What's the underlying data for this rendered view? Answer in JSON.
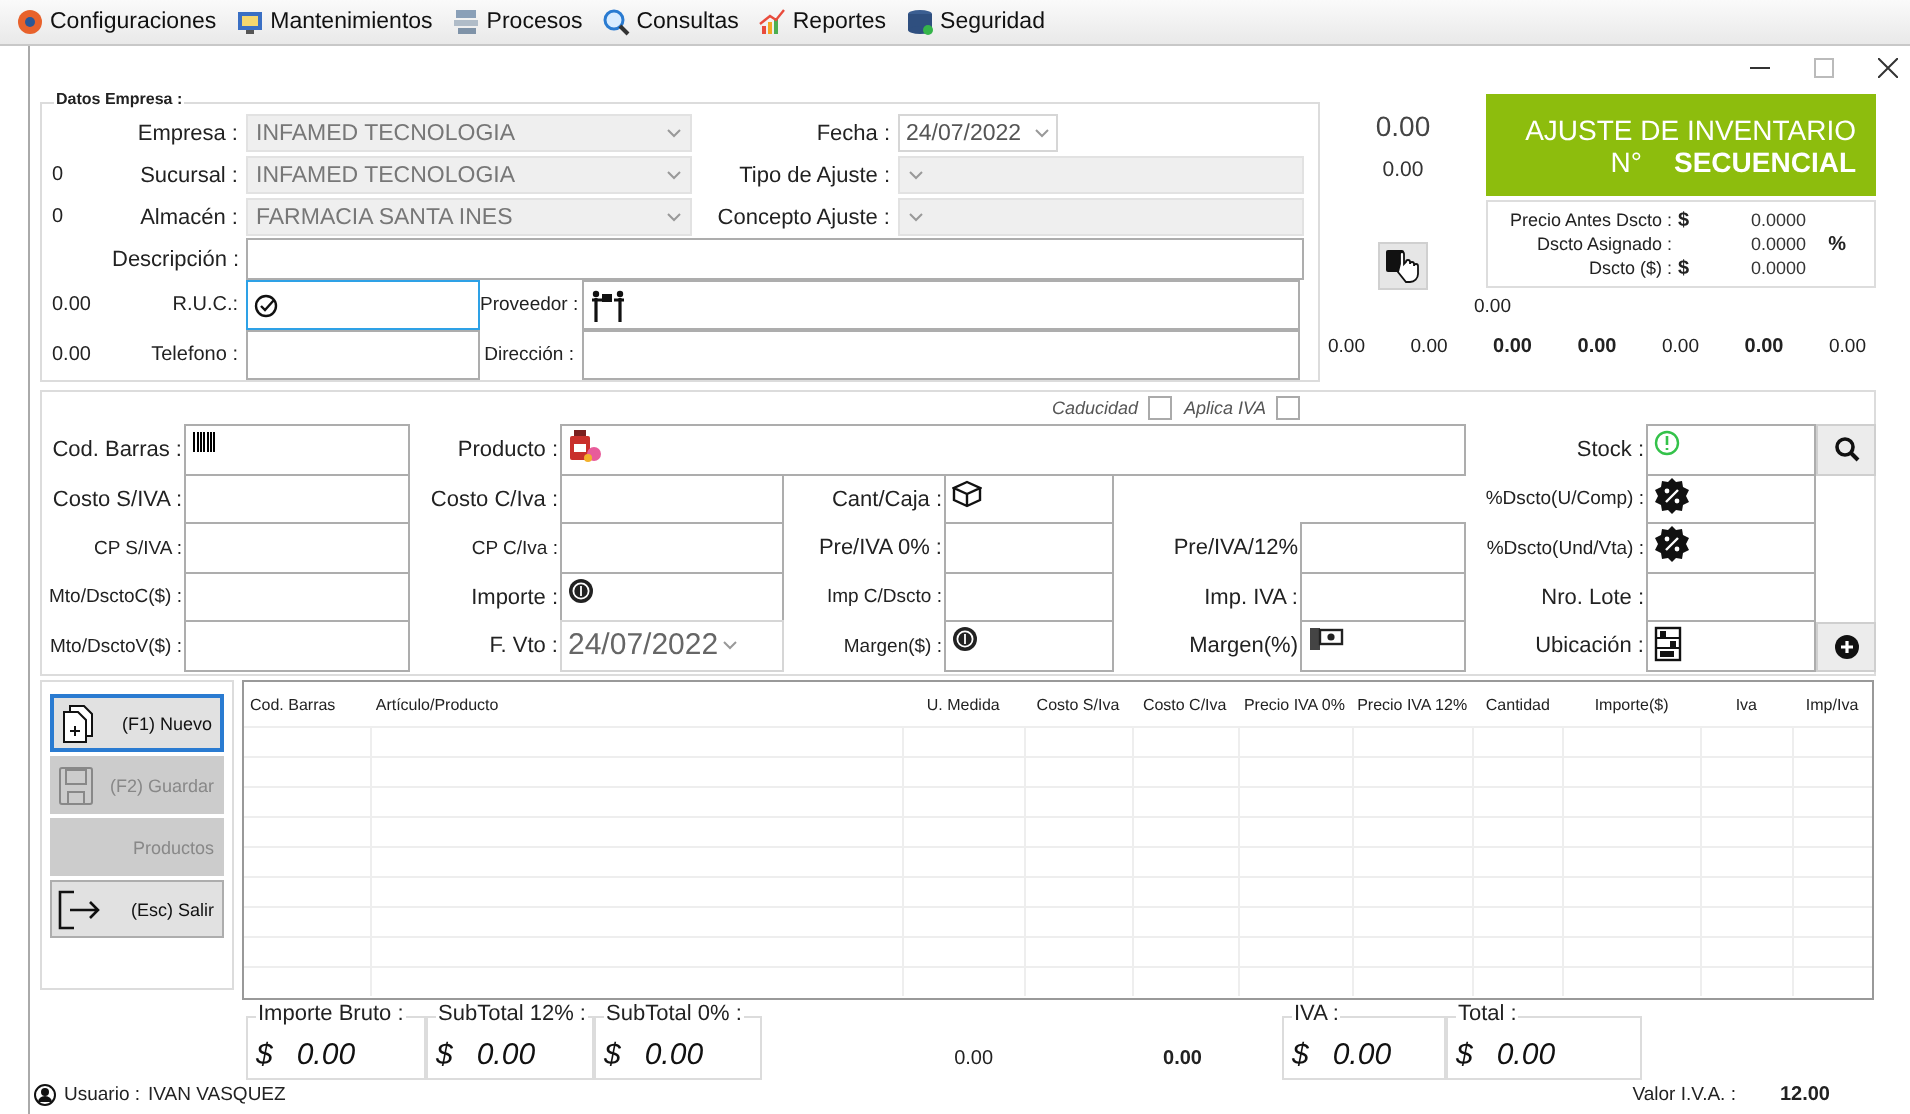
{
  "menu": [
    {
      "label": "Configuraciones"
    },
    {
      "label": "Mantenimientos"
    },
    {
      "label": "Procesos"
    },
    {
      "label": "Consultas"
    },
    {
      "label": "Reportes"
    },
    {
      "label": "Seguridad"
    }
  ],
  "company": {
    "title": "Datos Empresa :",
    "empresa": {
      "label": "Empresa :",
      "value": "INFAMED TECNOLOGIA",
      "disabled": true
    },
    "sucursal": {
      "code": "0",
      "label": "Sucursal :",
      "value": "INFAMED TECNOLOGIA",
      "disabled": true
    },
    "almacen": {
      "code": "0",
      "label": "Almacén :",
      "value": "FARMACIA SANTA INES",
      "disabled": true
    },
    "fecha": {
      "label": "Fecha :",
      "value": "24/07/2022"
    },
    "tipo_ajuste": {
      "label": "Tipo de Ajuste :"
    },
    "concepto_ajuste": {
      "label": "Concepto Ajuste :"
    },
    "descripcion": {
      "label": "Descripción :"
    },
    "ruc": {
      "code": "0.00",
      "label": "R.U.C.:",
      "focused": true
    },
    "proveedor": {
      "label": "Proveedor :"
    },
    "telefono": {
      "code": "0.00",
      "label": "Telefono :",
      "focused": false
    },
    "direccion": {
      "label": "Dirección :"
    }
  },
  "summary": {
    "big_value": "0.00",
    "small_value": "0.00",
    "side_value": "0.00",
    "totals": [
      {
        "value": "0.00",
        "bold": false
      },
      {
        "value": "0.00",
        "bold": false
      },
      {
        "value": "0.00",
        "bold": true
      },
      {
        "value": "0.00",
        "bold": true
      },
      {
        "value": "0.00",
        "bold": false
      },
      {
        "value": "0.00",
        "bold": true
      },
      {
        "value": "0.00",
        "bold": false
      }
    ]
  },
  "header": {
    "title": "AJUSTE DE INVENTARIO",
    "number_label": "N°",
    "number": "SECUENCIAL"
  },
  "prices": [
    {
      "label": "Precio Antes Dscto :",
      "currency": "$",
      "value": "0.0000"
    },
    {
      "label": "Dscto Asignado :",
      "value": "0.0000",
      "unit": "%"
    },
    {
      "label": "Dscto ($) :",
      "currency": "$",
      "value": "0.0000"
    }
  ],
  "product": {
    "checkboxes": [
      {
        "label": "Caducidad",
        "checked": false
      },
      {
        "label": "Aplica IVA",
        "checked": false
      }
    ],
    "fields": [
      {
        "label": "Cod. Barras :"
      },
      {
        "label": "Producto :"
      },
      {
        "label": "Stock :"
      },
      {
        "label": "Costo S/IVA :"
      },
      {
        "label": "Costo C/Iva :"
      },
      {
        "label": "Cant/Caja :"
      },
      {
        "label": "%Dscto(U/Comp) :"
      },
      {
        "label": "CP S/IVA :"
      },
      {
        "label": "CP C/Iva :"
      },
      {
        "label": "Pre/IVA 0% :"
      },
      {
        "label": "Pre/IVA/12%"
      },
      {
        "label": "%Dscto(Und/Vta) :"
      },
      {
        "label": "Mto/DsctoC($) :"
      },
      {
        "label": "Importe :"
      },
      {
        "label": "Imp C/Dscto :"
      },
      {
        "label": "Imp. IVA :"
      },
      {
        "label": "Nro. Lote :"
      },
      {
        "label": "Mto/DsctoV($) :"
      },
      {
        "label": "F. Vto :",
        "value": "24/07/2022"
      },
      {
        "label": "Margen($) :"
      },
      {
        "label": "Margen(%)"
      },
      {
        "label": "Ubicación :"
      }
    ]
  },
  "actions": [
    {
      "label": "(F1) Nuevo",
      "disabled": false,
      "focused": true
    },
    {
      "label": "(F2) Guardar",
      "disabled": true,
      "focused": false
    },
    {
      "label": "Productos",
      "disabled": true,
      "focused": false
    },
    {
      "label": "(Esc) Salir",
      "disabled": false,
      "focused": false
    }
  ],
  "table": {
    "columns": [
      "Cod. Barras",
      "Artículo/Producto",
      "U. Medida",
      "Costo S/Iva",
      "Costo C/Iva",
      "Precio IVA 0%",
      "Precio IVA 12%",
      "Cantidad",
      "Importe($)",
      "Iva",
      "Imp/Iva"
    ]
  },
  "subtotals": [
    {
      "label": "Importe Bruto :",
      "currency": "$",
      "value": "0.00"
    },
    {
      "label": "SubTotal 12% :",
      "currency": "$",
      "value": "0.00"
    },
    {
      "label": "SubTotal 0% :",
      "currency": "$",
      "value": "0.00"
    }
  ],
  "footer_values": [
    {
      "value": "0.00",
      "bold": false
    },
    {
      "value": "0.00",
      "bold": true
    }
  ],
  "grand": [
    {
      "label": "IVA :",
      "currency": "$",
      "value": "0.00"
    },
    {
      "label": "Total :",
      "currency": "$",
      "value": "0.00"
    }
  ],
  "iva_rate": {
    "label": "Valor I.V.A. :",
    "value": "12.00"
  },
  "status": {
    "label": "Usuario :",
    "value": "IVAN VASQUEZ"
  }
}
